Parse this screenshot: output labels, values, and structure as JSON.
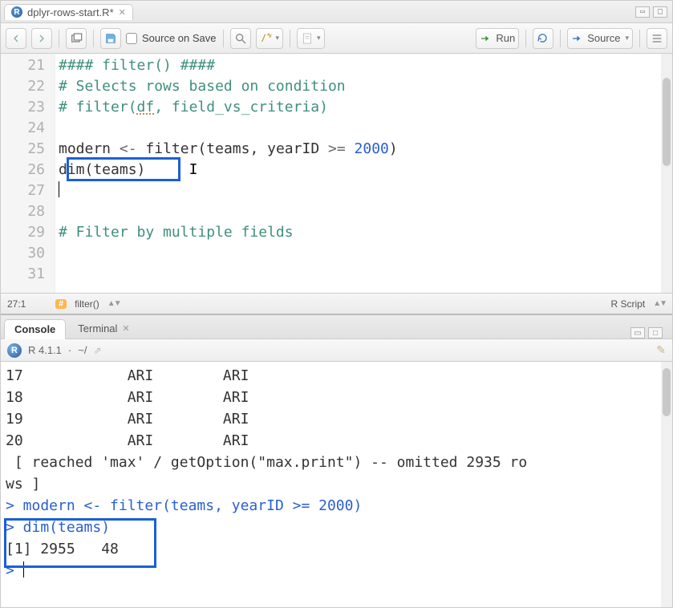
{
  "tabs": {
    "file_name": "dplyr-rows-start.R*"
  },
  "toolbar": {
    "source_on_save_label": "Source on Save",
    "run_label": "Run",
    "source_label": "Source"
  },
  "editor": {
    "line_start": 21,
    "lines": [
      {
        "n": 21,
        "type": "comment",
        "text": "#### filter() ####"
      },
      {
        "n": 22,
        "type": "comment",
        "text": "# Selects rows based on condition"
      },
      {
        "n": 23,
        "type": "comment_df",
        "prefix": "# filter(",
        "squig": "df",
        "suffix": ", field_vs_criteria)"
      },
      {
        "n": 24,
        "type": "blank",
        "text": ""
      },
      {
        "n": 25,
        "type": "assign",
        "lhs": "modern",
        "op": "<-",
        "fn": "filter",
        "args_pre": "(teams, yearID",
        "args_op": ">=",
        "num": "2000",
        "args_post": ")"
      },
      {
        "n": 26,
        "type": "call_caret",
        "text": "dim(teams)",
        "caret_after_spaces": "     "
      },
      {
        "n": 27,
        "type": "cursor_line",
        "text": ""
      },
      {
        "n": 28,
        "type": "blank",
        "text": ""
      },
      {
        "n": 29,
        "type": "comment",
        "text": "# Filter by multiple fields"
      },
      {
        "n": 30,
        "type": "blank",
        "text": ""
      },
      {
        "n": 31,
        "type": "blank",
        "text": ""
      }
    ]
  },
  "status": {
    "cursor_pos": "27:1",
    "scope": "filter()",
    "language": "R Script"
  },
  "console_tabs": {
    "console": "Console",
    "terminal": "Terminal"
  },
  "console_info": {
    "r_version": "R 4.1.1",
    "cwd": "~/"
  },
  "console": {
    "rows": [
      "17            ARI        ARI",
      "18            ARI        ARI",
      "19            ARI        ARI",
      "20            ARI        ARI",
      " [ reached 'max' / getOption(\"max.print\") -- omitted 2935 ro",
      "ws ]"
    ],
    "prompt1": "modern <- filter(teams, yearID >= 2000)",
    "prompt2": "dim(teams)",
    "result": "[1] 2955   48",
    "prompt_sym": ">"
  }
}
